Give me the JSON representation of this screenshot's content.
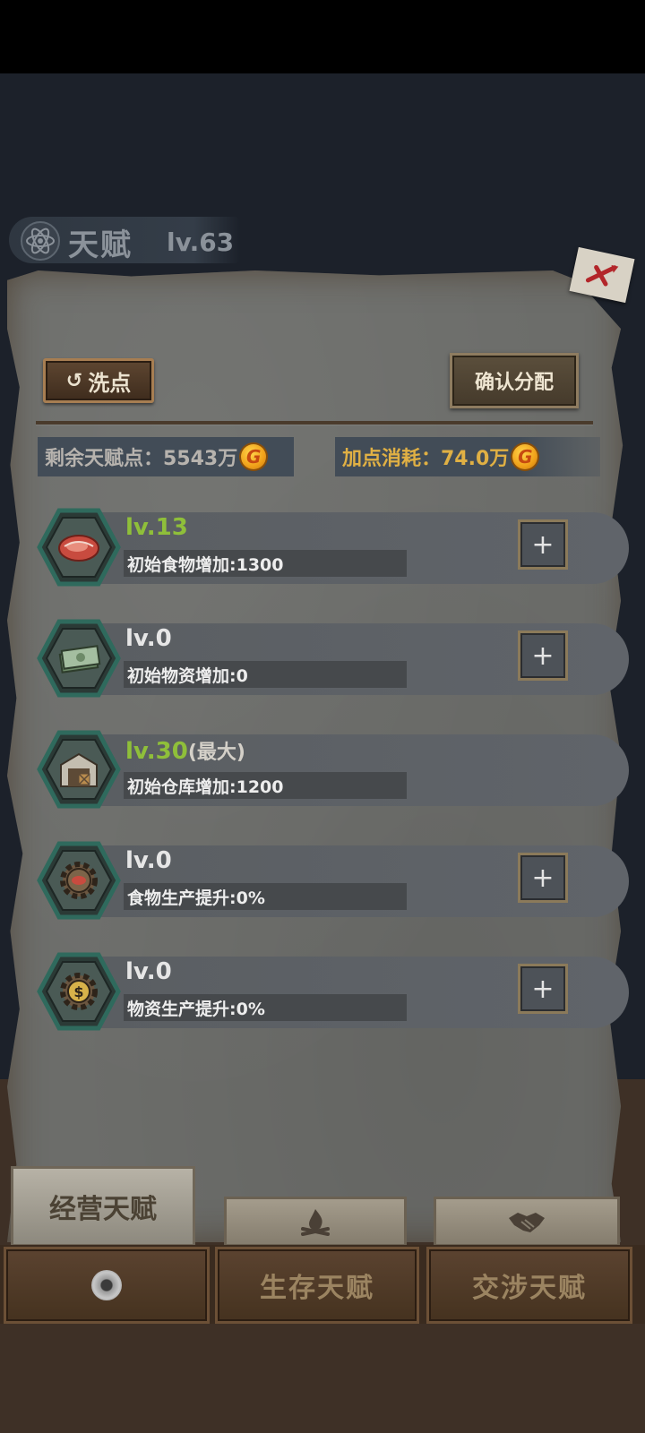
{
  "header": {
    "title": "天赋",
    "level": "lv.63"
  },
  "toolbar": {
    "wash_label": "洗点",
    "confirm_label": "确认分配"
  },
  "stats": {
    "remaining_label": "剩余天赋点：5543万",
    "cost_label": "加点消耗：74.0万",
    "coin_symbol": "G"
  },
  "talents": [
    {
      "icon": "meat-icon",
      "level": "lv.13",
      "max_tag": "",
      "desc": "初始食物增加:1300",
      "plus": "+"
    },
    {
      "icon": "money-stack-icon",
      "level": "lv.0",
      "max_tag": "",
      "desc": "初始物资增加:0",
      "plus": "+"
    },
    {
      "icon": "warehouse-icon",
      "level": "lv.30",
      "max_tag": "(最大)",
      "desc": "初始仓库增加:1200",
      "plus": ""
    },
    {
      "icon": "gear-meat-icon",
      "level": "lv.0",
      "max_tag": "",
      "desc": "食物生产提升:0%",
      "plus": "+"
    },
    {
      "icon": "gear-dollar-icon",
      "level": "lv.0",
      "max_tag": "",
      "desc": "物资生产提升:0%",
      "plus": "+"
    }
  ],
  "tabs": {
    "active_label": "经营天赋",
    "tab2_icon": "campfire-icon",
    "tab3_icon": "handshake-icon"
  },
  "bottom_nav": {
    "item1_icon": "disc-icon",
    "item2_label": "生存天赋",
    "item3_label": "交涉天赋"
  },
  "colors": {
    "level_green": "#8fbf3a",
    "cost_gold": "#e0b044",
    "hex_border": "#2f6a5d"
  }
}
